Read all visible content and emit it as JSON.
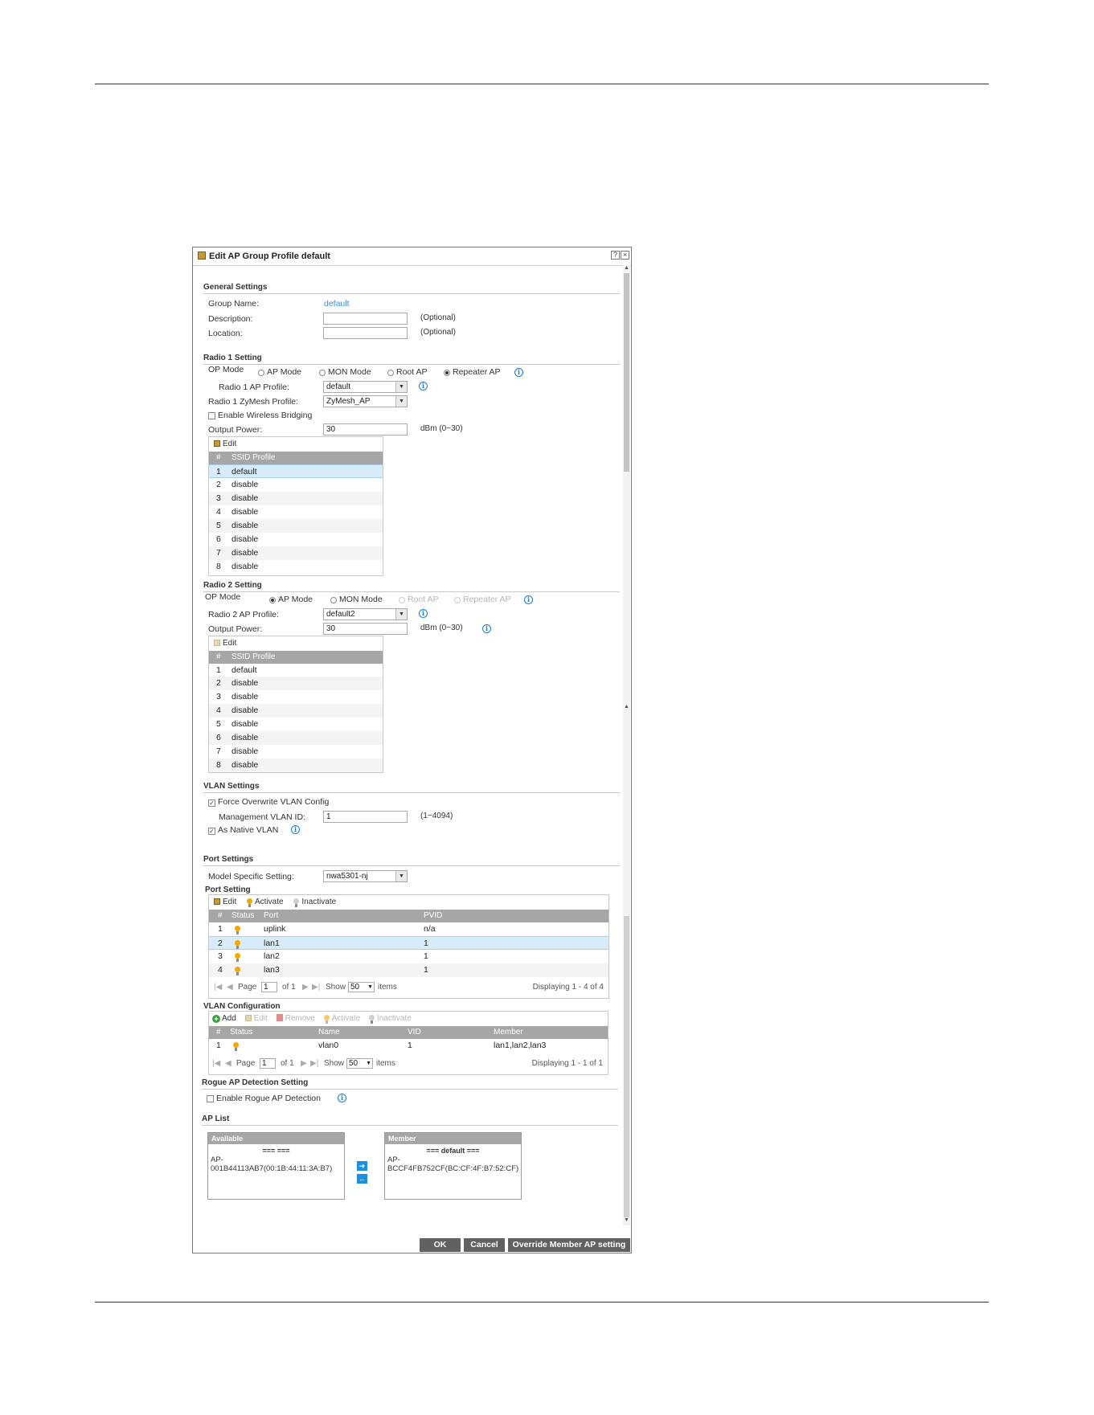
{
  "dialog": {
    "title": "Edit AP Group Profile default",
    "help_glyph": "?",
    "close_glyph": "×"
  },
  "general": {
    "heading": "General Settings",
    "group_name_label": "Group Name:",
    "group_name_value": "default",
    "description_label": "Description:",
    "description_value": "",
    "location_label": "Location:",
    "location_value": "",
    "optional": "(Optional)"
  },
  "radio1": {
    "heading": "Radio 1 Setting",
    "op_mode_label": "OP Mode",
    "modes": [
      "AP Mode",
      "MON Mode",
      "Root AP",
      "Repeater AP"
    ],
    "selected_mode": "Repeater AP",
    "ap_profile_label": "Radio 1 AP Profile:",
    "ap_profile_value": "default",
    "zymesh_label": "Radio 1 ZyMesh Profile:",
    "zymesh_value": "ZyMesh_AP",
    "bridging_label": "Enable Wireless Bridging",
    "bridging_checked": false,
    "output_power_label": "Output Power:",
    "output_power_value": "30",
    "output_power_unit": "dBm (0~30)",
    "edit_label": "Edit",
    "col_num": "#",
    "col_ssid": "SSID Profile",
    "ssids": [
      {
        "n": "1",
        "name": "default"
      },
      {
        "n": "2",
        "name": "disable"
      },
      {
        "n": "3",
        "name": "disable"
      },
      {
        "n": "4",
        "name": "disable"
      },
      {
        "n": "5",
        "name": "disable"
      },
      {
        "n": "6",
        "name": "disable"
      },
      {
        "n": "7",
        "name": "disable"
      },
      {
        "n": "8",
        "name": "disable"
      }
    ]
  },
  "radio2": {
    "heading": "Radio 2 Setting",
    "op_mode_label": "OP Mode",
    "modes": [
      "AP Mode",
      "MON Mode",
      "Root AP",
      "Repeater AP"
    ],
    "selected_mode": "AP Mode",
    "ap_profile_label": "Radio 2 AP Profile:",
    "ap_profile_value": "default2",
    "output_power_label": "Output Power:",
    "output_power_value": "30",
    "output_power_unit": "dBm (0~30)",
    "edit_label": "Edit",
    "col_num": "#",
    "col_ssid": "SSID Profile",
    "ssids": [
      {
        "n": "1",
        "name": "default"
      },
      {
        "n": "2",
        "name": "disable"
      },
      {
        "n": "3",
        "name": "disable"
      },
      {
        "n": "4",
        "name": "disable"
      },
      {
        "n": "5",
        "name": "disable"
      },
      {
        "n": "6",
        "name": "disable"
      },
      {
        "n": "7",
        "name": "disable"
      },
      {
        "n": "8",
        "name": "disable"
      }
    ]
  },
  "vlan": {
    "heading": "VLAN Settings",
    "force_label": "Force Overwrite VLAN Config",
    "force_checked": true,
    "mgmt_label": "Management VLAN ID:",
    "mgmt_value": "1",
    "mgmt_range": "(1~4094)",
    "native_label": "As Native VLAN",
    "native_checked": true
  },
  "ports": {
    "heading": "Port Settings",
    "model_label": "Model Specific Setting:",
    "model_value": "nwa5301-nj",
    "sub_heading": "Port Setting",
    "toolbar": {
      "edit": "Edit",
      "activate": "Activate",
      "inactivate": "Inactivate"
    },
    "columns": {
      "num": "#",
      "status": "Status",
      "port": "Port",
      "pvid": "PVID"
    },
    "rows": [
      {
        "n": "1",
        "port": "uplink",
        "pvid": "n/a"
      },
      {
        "n": "2",
        "port": "lan1",
        "pvid": "1"
      },
      {
        "n": "3",
        "port": "lan2",
        "pvid": "1"
      },
      {
        "n": "4",
        "port": "lan3",
        "pvid": "1"
      }
    ],
    "pager": {
      "page_label": "Page",
      "page_value": "1",
      "of_label": "of 1",
      "show_label": "Show",
      "show_value": "50",
      "items_label": "items",
      "displaying": "Displaying 1 - 4 of 4"
    }
  },
  "vlan_config": {
    "heading": "VLAN Configuration",
    "toolbar": {
      "add": "Add",
      "edit": "Edit",
      "remove": "Remove",
      "activate": "Activate",
      "inactivate": "Inactivate"
    },
    "columns": {
      "num": "#",
      "status": "Status",
      "name": "Name",
      "vid": "VID",
      "member": "Member"
    },
    "rows": [
      {
        "n": "1",
        "name": "vlan0",
        "vid": "1",
        "member": "lan1,lan2,lan3"
      }
    ],
    "pager": {
      "page_label": "Page",
      "page_value": "1",
      "of_label": "of 1",
      "show_label": "Show",
      "show_value": "50",
      "items_label": "items",
      "displaying": "Displaying 1 - 1 of 1"
    }
  },
  "rogue": {
    "heading": "Rogue AP Detection Setting",
    "enable_label": "Enable Rogue AP Detection",
    "enable_checked": false
  },
  "aplist": {
    "heading": "AP List",
    "available_label": "Available",
    "available_group": "=== ===",
    "available_item_1": "AP-",
    "available_item_2": "001B44113AB7(00:1B:44:11:3A:B7)",
    "member_label": "Member",
    "member_group": "=== default ===",
    "member_item_1": "AP-",
    "member_item_2": "BCCF4FB752CF(BC:CF:4F:B7:52:CF)",
    "add_glyph": "➔",
    "remove_glyph": "←"
  },
  "buttons": {
    "ok": "OK",
    "cancel": "Cancel",
    "override": "Override Member AP setting"
  },
  "colors": {
    "header_grey": "#a6a6a6",
    "button_grey": "#616161",
    "link_blue": "#3a8fd6",
    "bulb_orange": "#f4a900",
    "info_blue": "#1a7bd6"
  }
}
